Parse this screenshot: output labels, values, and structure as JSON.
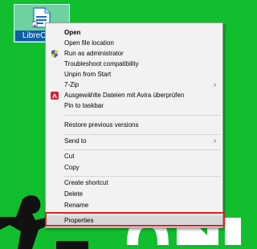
{
  "desktop": {
    "shortcut_label": "LibreOffice",
    "shortcut_icon": "libreoffice-file-icon"
  },
  "menu": {
    "items": [
      {
        "label": "Open",
        "bold": true
      },
      {
        "label": "Open file location"
      },
      {
        "label": "Run as administrator",
        "icon": "shield-icon"
      },
      {
        "label": "Troubleshoot compatibility"
      },
      {
        "label": "Unpin from Start"
      },
      {
        "label": "7-Zip",
        "submenu": true
      },
      {
        "label": "Ausgewählte Dateien mit Avira überprüfen",
        "icon": "avira-icon"
      },
      {
        "label": "Pin to taskbar"
      },
      {
        "label": "Restore previous versions"
      },
      {
        "label": "Send to",
        "submenu": true
      },
      {
        "label": "Cut"
      },
      {
        "label": "Copy"
      },
      {
        "label": "Create shortcut"
      },
      {
        "label": "Delete"
      },
      {
        "label": "Rename"
      },
      {
        "label": "Properties",
        "highlighted": true
      }
    ],
    "submenu_arrow": "›"
  },
  "colors": {
    "desktop_bg": "#11bf2e",
    "highlight_outline": "#d6262c"
  }
}
